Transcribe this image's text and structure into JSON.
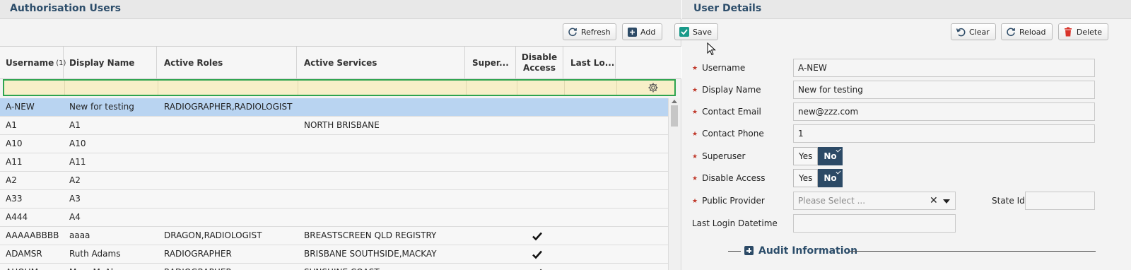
{
  "users_panel": {
    "title": "Authorisation Users",
    "refresh_label": "Refresh",
    "add_label": "Add",
    "columns": {
      "username": "Username",
      "username_sort": "(1)",
      "display_name": "Display Name",
      "active_roles": "Active Roles",
      "active_services": "Active Services",
      "superuser": "Super...",
      "disable_access_1": "Disable",
      "disable_access_2": "Access",
      "last_login": "Last Lo..."
    },
    "rows": [
      {
        "username": "A-NEW",
        "display_name": "New for testing",
        "roles": "RADIOGRAPHER,RADIOLOGIST",
        "services": "",
        "disabled": false,
        "selected": true
      },
      {
        "username": "A1",
        "display_name": "A1",
        "roles": "",
        "services": "NORTH BRISBANE",
        "disabled": false
      },
      {
        "username": "A10",
        "display_name": "A10",
        "roles": "",
        "services": "",
        "disabled": false
      },
      {
        "username": "A11",
        "display_name": "A11",
        "roles": "",
        "services": "",
        "disabled": false
      },
      {
        "username": "A2",
        "display_name": "A2",
        "roles": "",
        "services": "",
        "disabled": false
      },
      {
        "username": "A33",
        "display_name": "A3",
        "roles": "",
        "services": "",
        "disabled": false
      },
      {
        "username": "A444",
        "display_name": "A4",
        "roles": "",
        "services": "",
        "disabled": false
      },
      {
        "username": "AAAAABBBB",
        "display_name": "aaaa",
        "roles": "DRAGON,RADIOLOGIST",
        "services": "BREASTSCREEN QLD REGISTRY",
        "disabled": true
      },
      {
        "username": "ADAMSR",
        "display_name": "Ruth Adams",
        "roles": "RADIOGRAPHER",
        "services": "BRISBANE SOUTHSIDE,MACKAY",
        "disabled": true
      },
      {
        "username": "AHOHM",
        "display_name": "Mary McAl...",
        "roles": "RADIOGRAPHER",
        "services": "SUNSHINE COAST",
        "disabled": true
      }
    ]
  },
  "details_panel": {
    "title": "User Details",
    "save_label": "Save",
    "clear_label": "Clear",
    "reload_label": "Reload",
    "delete_label": "Delete",
    "fields": {
      "username_label": "Username",
      "username_value": "A-NEW",
      "display_name_label": "Display Name",
      "display_name_value": "New for testing",
      "contact_email_label": "Contact Email",
      "contact_email_value": "new@zzz.com",
      "contact_phone_label": "Contact Phone",
      "contact_phone_value": "1",
      "superuser_label": "Superuser",
      "disable_access_label": "Disable Access",
      "public_provider_label": "Public Provider",
      "public_provider_placeholder": "Please Select ...",
      "state_id_label": "State Id",
      "last_login_label": "Last Login Datetime"
    },
    "toggle": {
      "yes": "Yes",
      "no": "No"
    },
    "audit_label": "Audit Information"
  },
  "colors": {
    "accent": "#2c4a66",
    "selection": "#b9d4f1",
    "filter_border": "#2ea44f",
    "required_star": "#c0392b"
  }
}
